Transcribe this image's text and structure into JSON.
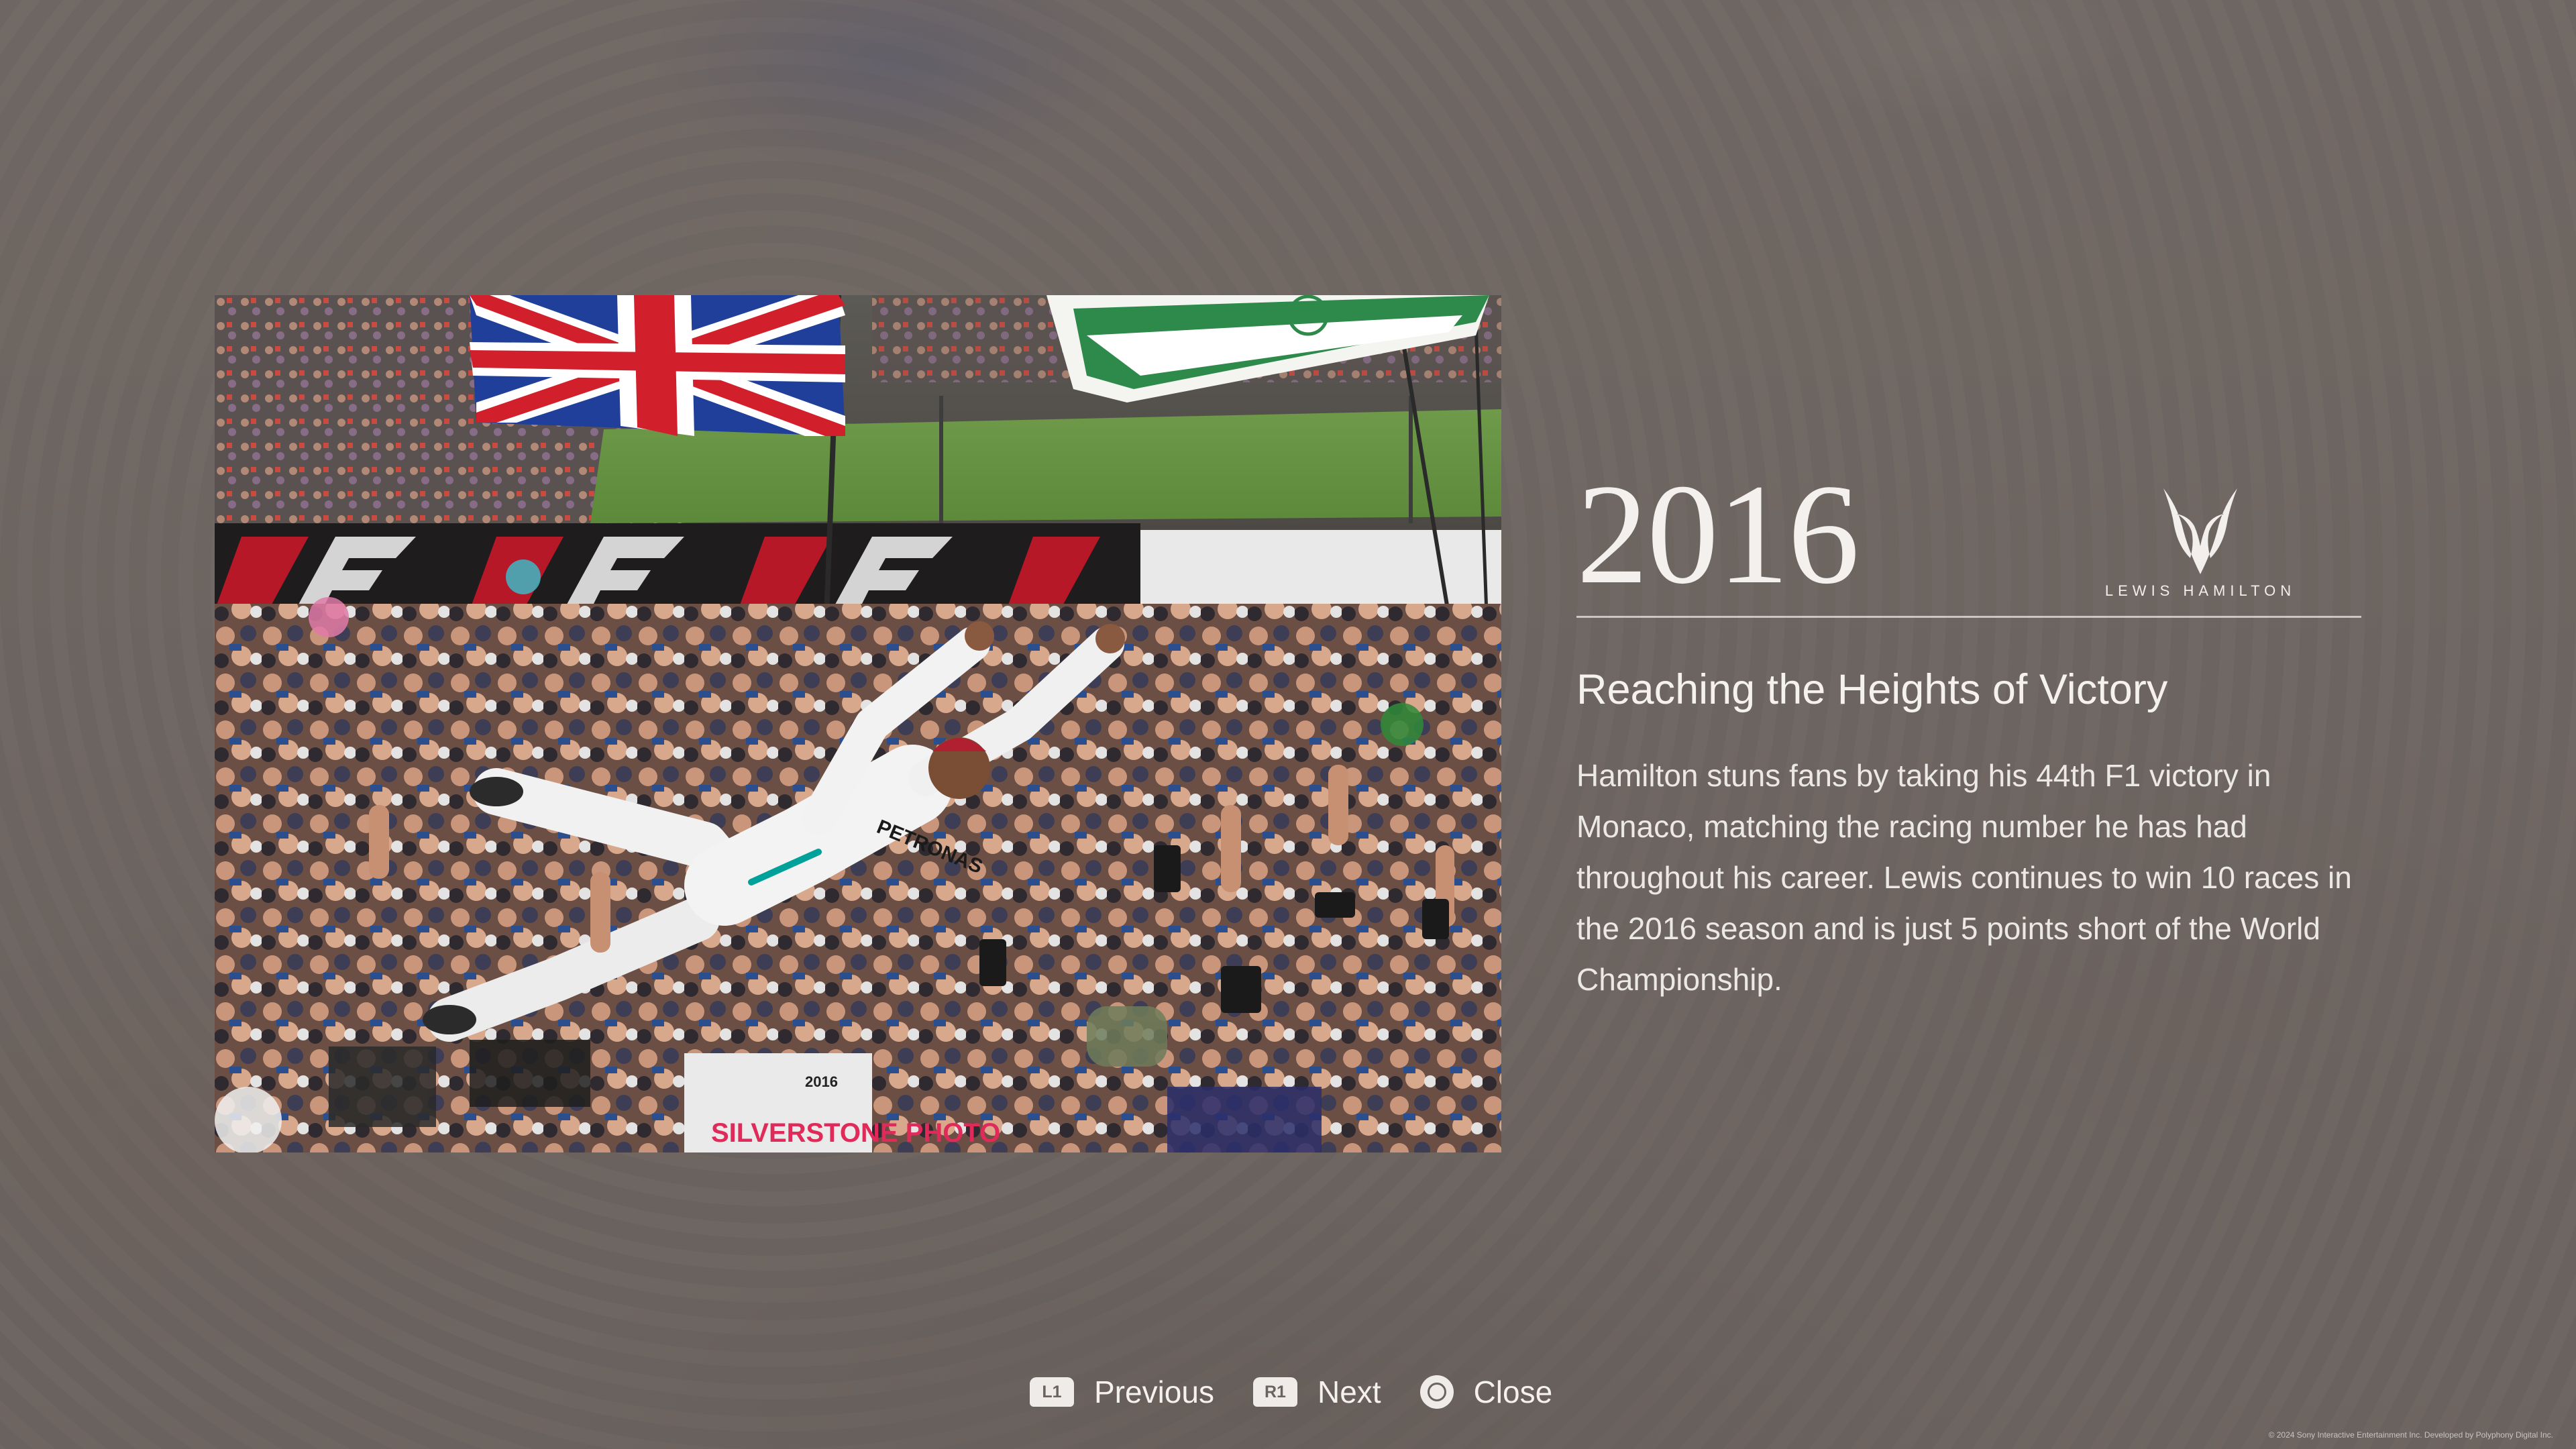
{
  "photo": {
    "description_icon": "crowd-surfing-photo",
    "shirt_text": "PETRONAS",
    "shirt_text_2": "SILVERSTONE PHOTO",
    "badge_text": "2016"
  },
  "info": {
    "year": "2016",
    "brand_name": "LEWIS HAMILTON",
    "headline": "Reaching the Heights of Victory",
    "body": "Hamilton stuns fans by taking his 44th F1 victory in Monaco, matching the racing number he has had throughout his career. Lewis continues to win 10 races in the 2016 season and is just 5 points short of the World Championship."
  },
  "controls": {
    "previous": {
      "badge": "L1",
      "label": "Previous"
    },
    "next": {
      "badge": "R1",
      "label": "Next"
    },
    "close": {
      "icon": "circle-button-icon",
      "label": "Close"
    }
  },
  "footer": {
    "copyright": "© 2024 Sony Interactive Entertainment Inc. Developed by Polyphony Digital Inc."
  },
  "colors": {
    "background": "#6f6864",
    "text": "#f3f0ed",
    "badge_bg": "#efebe8",
    "badge_text": "#6b635f"
  }
}
